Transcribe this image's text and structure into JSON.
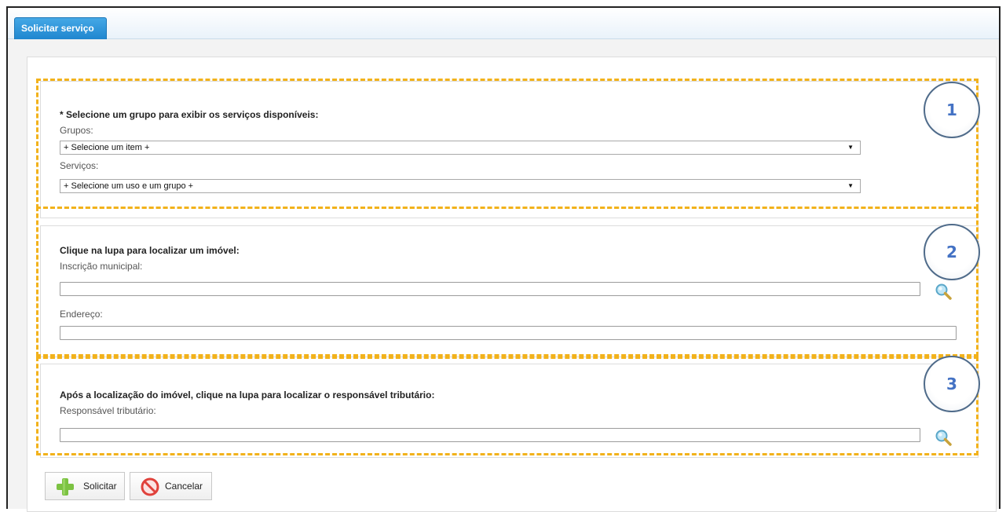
{
  "tab": {
    "label": "Solicitar serviço"
  },
  "section1": {
    "heading": "* Selecione um grupo para exibir os serviços disponíveis:",
    "grupos_label": "Grupos:",
    "grupos_value": "+ Selecione um item +",
    "servicos_label": "Serviços:",
    "servicos_value": "+ Selecione um uso e um grupo +"
  },
  "section2": {
    "heading": "Clique na lupa para localizar um imóvel:",
    "inscricao_label": "Inscrição municipal:",
    "inscricao_value": "",
    "endereco_label": "Endereço:",
    "endereco_value": ""
  },
  "section3": {
    "heading": "Após a localização do imóvel, clique na lupa para localizar o responsável tributário:",
    "responsavel_label": "Responsável tributário:",
    "responsavel_value": ""
  },
  "badges": [
    "1",
    "2",
    "3"
  ],
  "buttons": {
    "solicitar": "Solicitar",
    "cancelar": "Cancelar"
  },
  "colors": {
    "accent_tab": "#2a93da",
    "highlight_dash": "#f2b21b",
    "badge_text": "#4472c4",
    "plus_icon": "#7cc242",
    "cancel_icon": "#e0413b"
  },
  "icons": [
    "search-icon",
    "add-icon",
    "cancel-icon",
    "chevron-down-icon"
  ]
}
